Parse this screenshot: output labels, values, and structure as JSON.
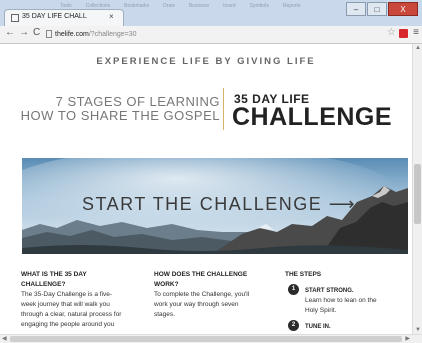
{
  "browser": {
    "tab_title": "35 DAY LIFE CHALL",
    "tab_close": "×",
    "url_host": "thelife.com",
    "url_path": "/?challenge=30",
    "back_icon": "←",
    "forward_icon": "→",
    "reload_icon": "C",
    "star_icon": "☆",
    "menu_icon": "≡",
    "window_controls": {
      "minimize": "–",
      "maximize": "□",
      "close": "X"
    }
  },
  "page": {
    "tagline": "EXPERIENCE LIFE BY GIVING LIFE",
    "stages_line1": "7 STAGES OF LEARNING",
    "stages_line2": "HOW TO SHARE THE GOSPEL",
    "challenge_small": "35 DAY LIFE",
    "challenge_big": "CHALLENGE",
    "hero_title": "START THE CHALLENGE ⟶",
    "col1": {
      "heading1": "WHAT IS THE 35 DAY",
      "heading2": "CHALLENGE?",
      "line1": "The 35-Day Challenge is a five-",
      "line2": "week journey that will walk you",
      "line3": "through a clear, natural process for",
      "line4": "engaging the people around you"
    },
    "col2": {
      "heading1": "HOW DOES THE CHALLENGE",
      "heading2": "WORK?",
      "line1": "To complete the Challenge, you'll",
      "line2": "work your way through seven",
      "line3": "stages."
    },
    "col3": {
      "heading": "THE STEPS",
      "steps": [
        {
          "num": "1",
          "title": "START STRONG.",
          "desc1": "Learn how to lean on the",
          "desc2": "Holy Spirit."
        },
        {
          "num": "2",
          "title": "TUNE IN."
        }
      ]
    }
  },
  "colors": {
    "accent_gold": "#d8b36a",
    "text_dark": "#222222"
  }
}
